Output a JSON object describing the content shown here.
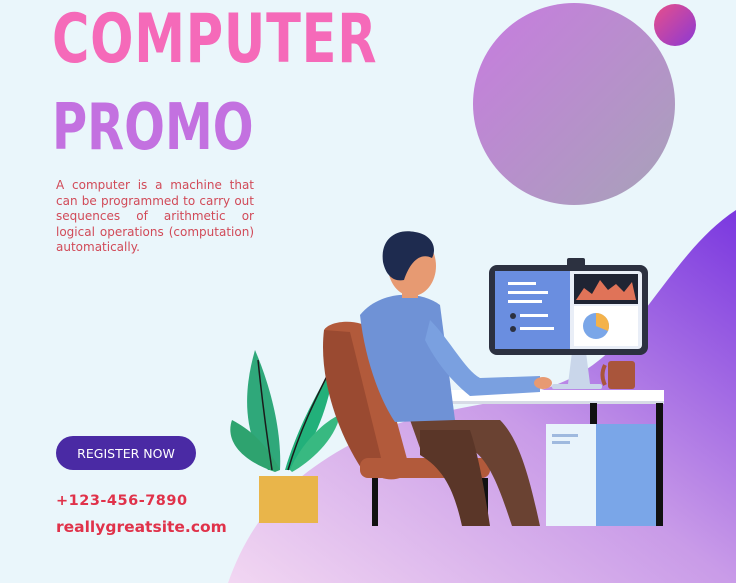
{
  "headline": {
    "line1": "COMPUTER",
    "line2": "PROMO"
  },
  "description": "A computer is a machine that can be programmed to carry out sequences of arithmetic or logical operations (computation) automatically.",
  "cta": {
    "label": "REGISTER NOW"
  },
  "contact": {
    "phone": "+123-456-7890",
    "website": "reallygreatsite.com"
  },
  "colors": {
    "background": "#eaf6fb",
    "pink": "#f56ab9",
    "violet": "#c371e0",
    "button": "#4a2aa4",
    "contact_text": "#e0324a",
    "wave_purple": "#7f3fe0"
  },
  "illustration": {
    "subject": "man-working-at-desktop-computer",
    "icons": [
      "gradient-circle-large",
      "gradient-circle-small",
      "plant-icon",
      "office-chair-icon",
      "monitor-icon",
      "coffee-mug-icon",
      "desk-icon",
      "pc-tower-icon"
    ]
  }
}
